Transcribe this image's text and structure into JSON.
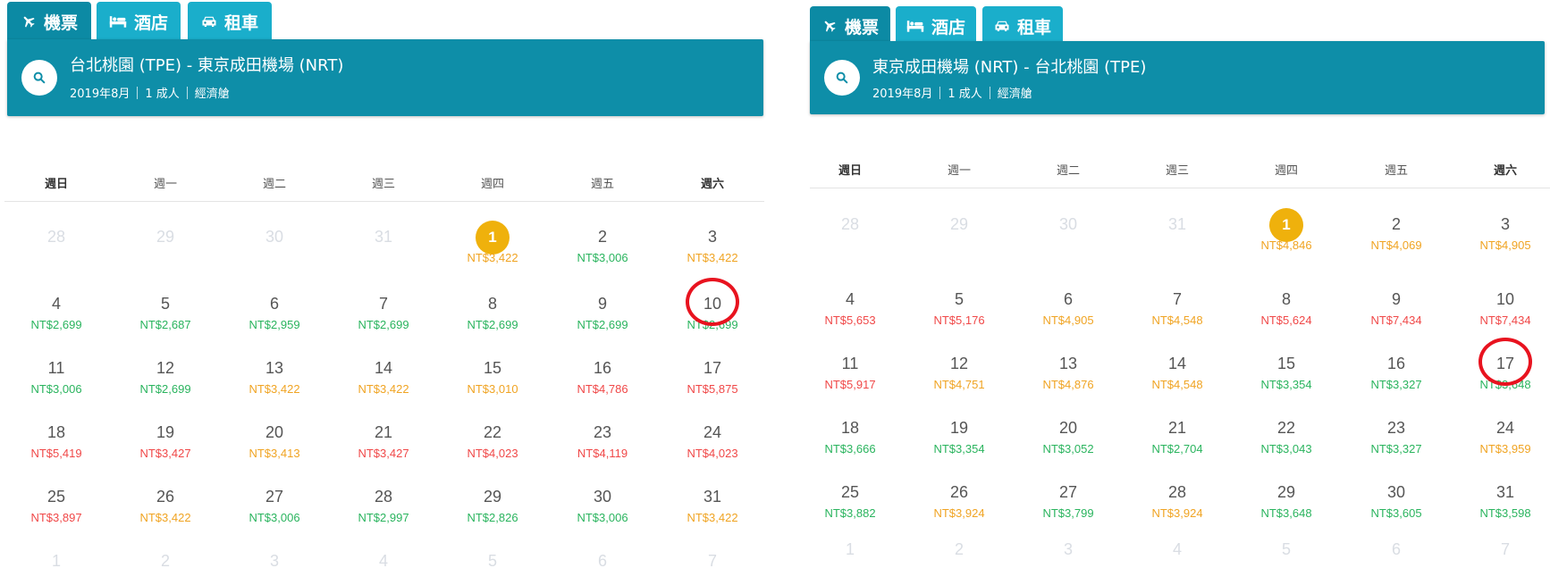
{
  "tabs": [
    {
      "label": "機票",
      "icon": "plane-icon",
      "active": true
    },
    {
      "label": "酒店",
      "icon": "bed-icon",
      "active": false
    },
    {
      "label": "租車",
      "icon": "car-icon",
      "active": false
    }
  ],
  "weekdays": [
    "週日",
    "週一",
    "週二",
    "週三",
    "週四",
    "週五",
    "週六"
  ],
  "colors": {
    "cheap": "#2ab45e",
    "medium": "#f0a423",
    "expensive": "#f04848",
    "selected_badge": "#efb10c",
    "highlight_ring": "#e8131f"
  },
  "panels": [
    {
      "route": "台北桃園 (TPE) - 東京成田機場 (NRT)",
      "month": "2019年8月",
      "passengers": "1 成人",
      "cabin": "經濟艙",
      "prev_month_days": [
        "28",
        "29",
        "30",
        "31"
      ],
      "next_month_days": [
        "1",
        "2",
        "3",
        "4",
        "5",
        "6",
        "7"
      ],
      "selected_day": "1",
      "circled_day": "10",
      "days": [
        {
          "day": "1",
          "price": "NT$3,422",
          "tier": "orange"
        },
        {
          "day": "2",
          "price": "NT$3,006",
          "tier": "green"
        },
        {
          "day": "3",
          "price": "NT$3,422",
          "tier": "orange"
        },
        {
          "day": "4",
          "price": "NT$2,699",
          "tier": "green"
        },
        {
          "day": "5",
          "price": "NT$2,687",
          "tier": "green"
        },
        {
          "day": "6",
          "price": "NT$2,959",
          "tier": "green"
        },
        {
          "day": "7",
          "price": "NT$2,699",
          "tier": "green"
        },
        {
          "day": "8",
          "price": "NT$2,699",
          "tier": "green"
        },
        {
          "day": "9",
          "price": "NT$2,699",
          "tier": "green"
        },
        {
          "day": "10",
          "price": "NT$2,699",
          "tier": "green"
        },
        {
          "day": "11",
          "price": "NT$3,006",
          "tier": "green"
        },
        {
          "day": "12",
          "price": "NT$2,699",
          "tier": "green"
        },
        {
          "day": "13",
          "price": "NT$3,422",
          "tier": "orange"
        },
        {
          "day": "14",
          "price": "NT$3,422",
          "tier": "orange"
        },
        {
          "day": "15",
          "price": "NT$3,010",
          "tier": "orange"
        },
        {
          "day": "16",
          "price": "NT$4,786",
          "tier": "red"
        },
        {
          "day": "17",
          "price": "NT$5,875",
          "tier": "red"
        },
        {
          "day": "18",
          "price": "NT$5,419",
          "tier": "red"
        },
        {
          "day": "19",
          "price": "NT$3,427",
          "tier": "red"
        },
        {
          "day": "20",
          "price": "NT$3,413",
          "tier": "orange"
        },
        {
          "day": "21",
          "price": "NT$3,427",
          "tier": "red"
        },
        {
          "day": "22",
          "price": "NT$4,023",
          "tier": "red"
        },
        {
          "day": "23",
          "price": "NT$4,119",
          "tier": "red"
        },
        {
          "day": "24",
          "price": "NT$4,023",
          "tier": "red"
        },
        {
          "day": "25",
          "price": "NT$3,897",
          "tier": "red"
        },
        {
          "day": "26",
          "price": "NT$3,422",
          "tier": "orange"
        },
        {
          "day": "27",
          "price": "NT$3,006",
          "tier": "green"
        },
        {
          "day": "28",
          "price": "NT$2,997",
          "tier": "green"
        },
        {
          "day": "29",
          "price": "NT$2,826",
          "tier": "green"
        },
        {
          "day": "30",
          "price": "NT$3,006",
          "tier": "green"
        },
        {
          "day": "31",
          "price": "NT$3,422",
          "tier": "orange"
        }
      ]
    },
    {
      "route": "東京成田機場 (NRT) - 台北桃園 (TPE)",
      "month": "2019年8月",
      "passengers": "1 成人",
      "cabin": "經濟艙",
      "prev_month_days": [
        "28",
        "29",
        "30",
        "31"
      ],
      "next_month_days": [
        "1",
        "2",
        "3",
        "4",
        "5",
        "6",
        "7"
      ],
      "selected_day": "1",
      "circled_day": "17",
      "days": [
        {
          "day": "1",
          "price": "NT$4,846",
          "tier": "orange"
        },
        {
          "day": "2",
          "price": "NT$4,069",
          "tier": "orange"
        },
        {
          "day": "3",
          "price": "NT$4,905",
          "tier": "orange"
        },
        {
          "day": "4",
          "price": "NT$5,653",
          "tier": "red"
        },
        {
          "day": "5",
          "price": "NT$5,176",
          "tier": "red"
        },
        {
          "day": "6",
          "price": "NT$4,905",
          "tier": "orange"
        },
        {
          "day": "7",
          "price": "NT$4,548",
          "tier": "orange"
        },
        {
          "day": "8",
          "price": "NT$5,624",
          "tier": "red"
        },
        {
          "day": "9",
          "price": "NT$7,434",
          "tier": "red"
        },
        {
          "day": "10",
          "price": "NT$7,434",
          "tier": "red"
        },
        {
          "day": "11",
          "price": "NT$5,917",
          "tier": "red"
        },
        {
          "day": "12",
          "price": "NT$4,751",
          "tier": "orange"
        },
        {
          "day": "13",
          "price": "NT$4,876",
          "tier": "orange"
        },
        {
          "day": "14",
          "price": "NT$4,548",
          "tier": "orange"
        },
        {
          "day": "15",
          "price": "NT$3,354",
          "tier": "green"
        },
        {
          "day": "16",
          "price": "NT$3,327",
          "tier": "green"
        },
        {
          "day": "17",
          "price": "NT$3,648",
          "tier": "green"
        },
        {
          "day": "18",
          "price": "NT$3,666",
          "tier": "green"
        },
        {
          "day": "19",
          "price": "NT$3,354",
          "tier": "green"
        },
        {
          "day": "20",
          "price": "NT$3,052",
          "tier": "green"
        },
        {
          "day": "21",
          "price": "NT$2,704",
          "tier": "green"
        },
        {
          "day": "22",
          "price": "NT$3,043",
          "tier": "green"
        },
        {
          "day": "23",
          "price": "NT$3,327",
          "tier": "green"
        },
        {
          "day": "24",
          "price": "NT$3,959",
          "tier": "orange"
        },
        {
          "day": "25",
          "price": "NT$3,882",
          "tier": "green"
        },
        {
          "day": "26",
          "price": "NT$3,924",
          "tier": "orange"
        },
        {
          "day": "27",
          "price": "NT$3,799",
          "tier": "green"
        },
        {
          "day": "28",
          "price": "NT$3,924",
          "tier": "orange"
        },
        {
          "day": "29",
          "price": "NT$3,648",
          "tier": "green"
        },
        {
          "day": "30",
          "price": "NT$3,605",
          "tier": "green"
        },
        {
          "day": "31",
          "price": "NT$3,598",
          "tier": "green"
        }
      ]
    }
  ]
}
